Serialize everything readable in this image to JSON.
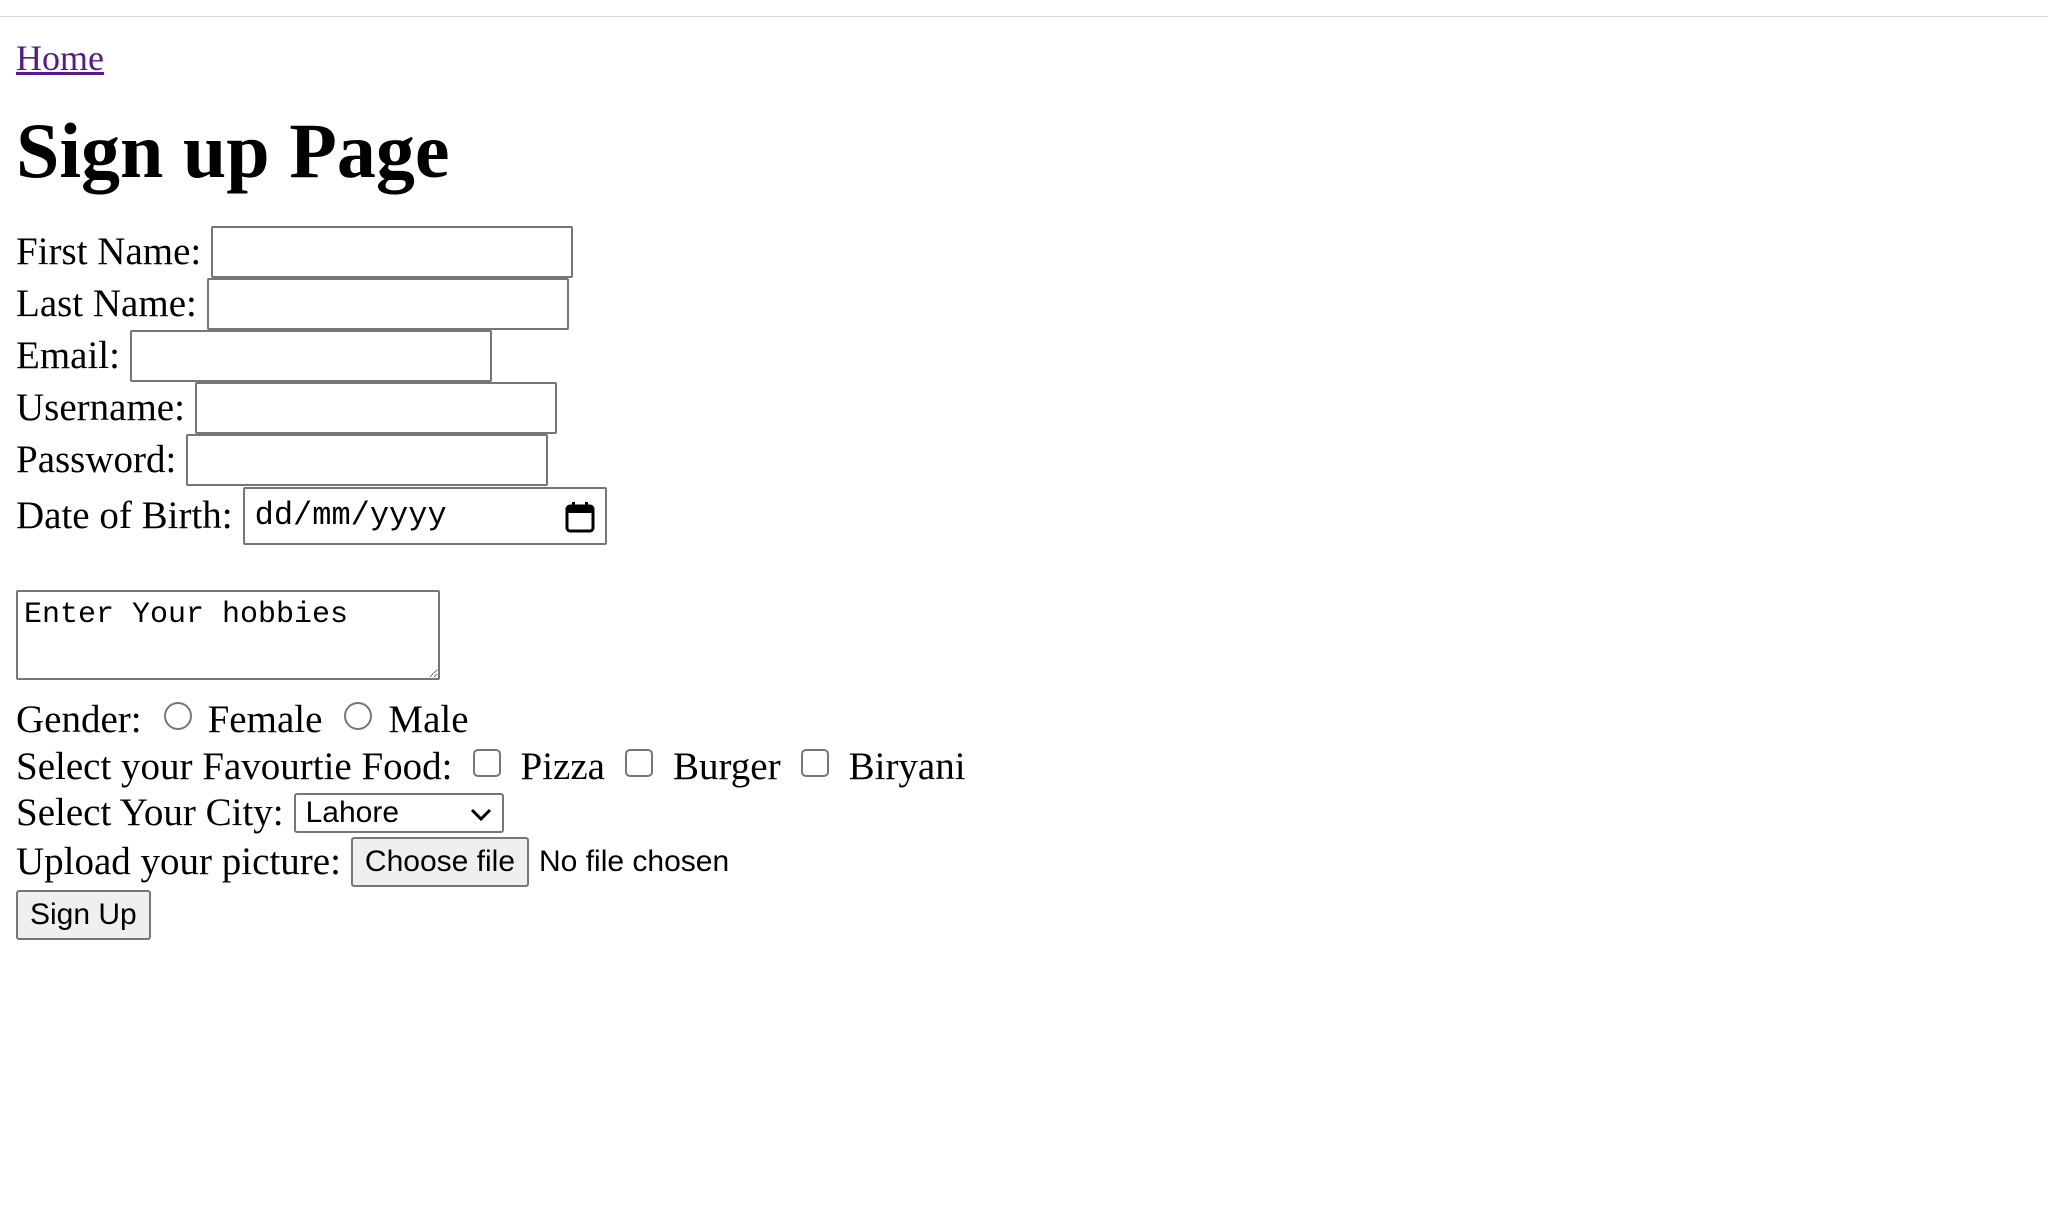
{
  "nav": {
    "home_link": "Home"
  },
  "page_title": "Sign up Page",
  "form": {
    "first_name_label": "First Name:",
    "last_name_label": "Last Name:",
    "email_label": "Email:",
    "username_label": "Username:",
    "password_label": "Password:",
    "dob_label": "Date of Birth:",
    "dob_placeholder": "dd/mm/yyyy",
    "hobbies_placeholder": "Enter Your hobbies",
    "gender_label": "Gender:",
    "gender_options": [
      "Female",
      "Male"
    ],
    "food_label": "Select your Favourtie Food:",
    "food_options": [
      "Pizza",
      "Burger",
      "Biryani"
    ],
    "city_label": "Select Your City:",
    "city_selected": "Lahore",
    "picture_label": "Upload your picture:",
    "choose_file_label": "Choose file",
    "no_file_text": "No file chosen",
    "submit_label": "Sign Up"
  },
  "icons": {
    "date": "calendar-icon",
    "select": "chevron-down-icon"
  },
  "colors": {
    "visited_link": "#551a8b",
    "border": "#767676",
    "button_bg": "#efefef"
  }
}
